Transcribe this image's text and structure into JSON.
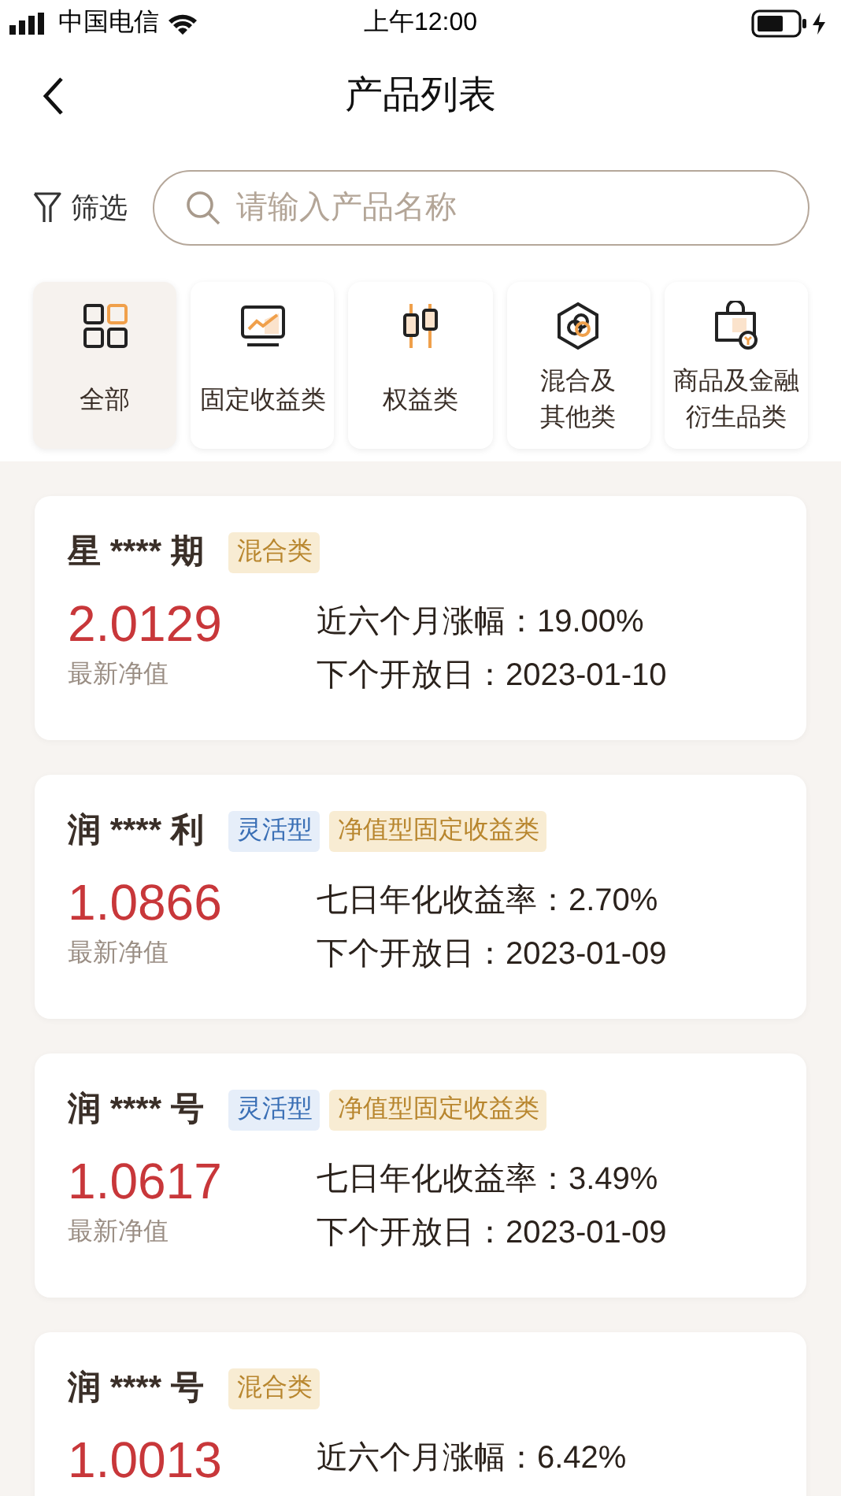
{
  "status_bar": {
    "carrier": "中国电信",
    "time": "上午12:00"
  },
  "nav": {
    "title": "产品列表"
  },
  "filter": {
    "label": "筛选"
  },
  "search": {
    "placeholder": "请输入产品名称"
  },
  "categories": [
    {
      "label": "全部",
      "selected": true
    },
    {
      "label": "固定收益类",
      "selected": false
    },
    {
      "label": "权益类",
      "selected": false
    },
    {
      "label": "混合及其他类",
      "selected": false
    },
    {
      "label": "商品及金融衍生品类",
      "selected": false
    }
  ],
  "products": [
    {
      "name": "星 **** 期",
      "tags": [
        {
          "label": "混合类",
          "kind": "category"
        }
      ],
      "value": "2.0129",
      "value_label": "最新净值",
      "stats": [
        "近六个月涨幅：19.00%",
        "下个开放日：2023-01-10"
      ]
    },
    {
      "name": "润 **** 利",
      "tags": [
        {
          "label": "灵活型",
          "kind": "style"
        },
        {
          "label": "净值型固定收益类",
          "kind": "category"
        }
      ],
      "value": "1.0866",
      "value_label": "最新净值",
      "stats": [
        "七日年化收益率：2.70%",
        "下个开放日：2023-01-09"
      ]
    },
    {
      "name": "润 **** 号",
      "tags": [
        {
          "label": "灵活型",
          "kind": "style"
        },
        {
          "label": "净值型固定收益类",
          "kind": "category"
        }
      ],
      "value": "1.0617",
      "value_label": "最新净值",
      "stats": [
        "七日年化收益率：3.49%",
        "下个开放日：2023-01-09"
      ]
    },
    {
      "name": "润 **** 号",
      "tags": [
        {
          "label": "混合类",
          "kind": "category"
        }
      ],
      "value": "1.0013",
      "stats": [
        "近六个月涨幅：6.42%"
      ]
    }
  ]
}
